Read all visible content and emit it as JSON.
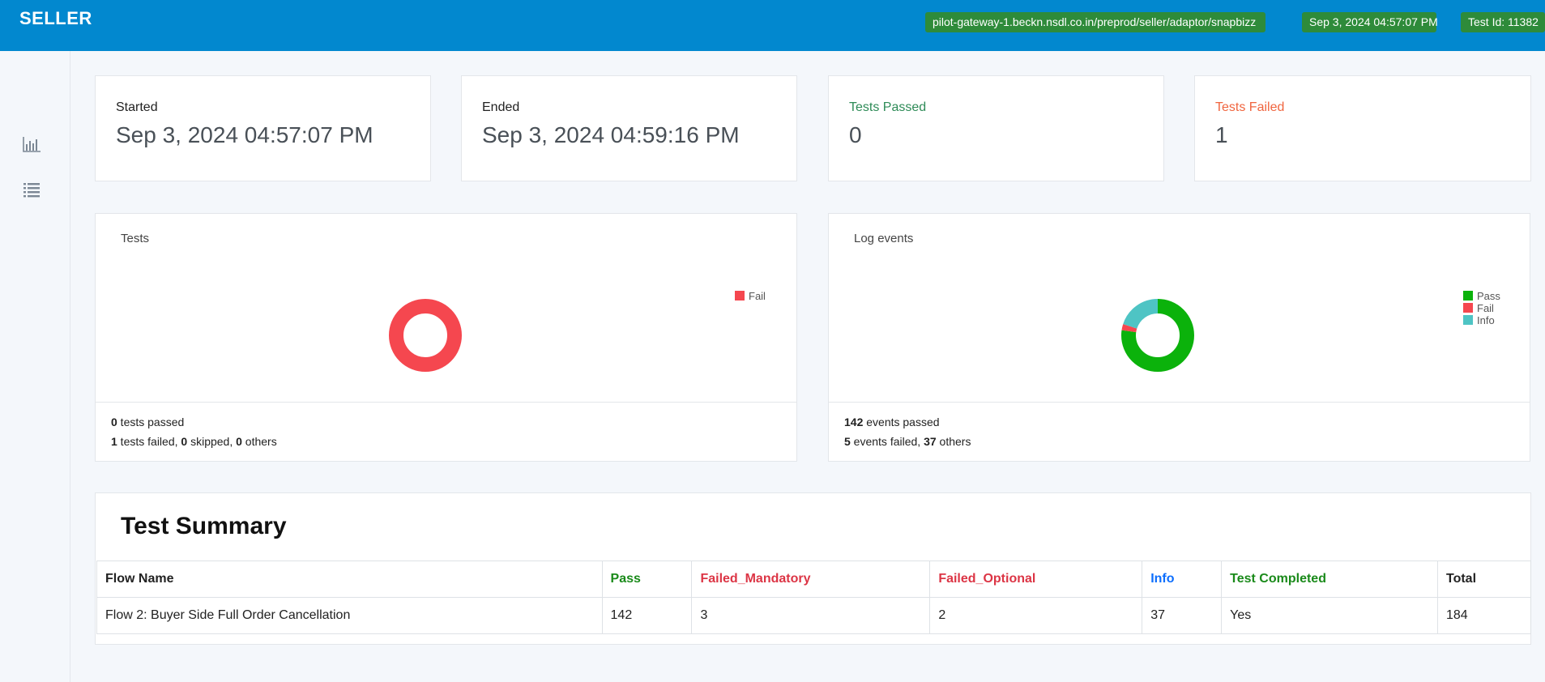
{
  "header": {
    "brand": "SELLER",
    "url_badge": "pilot-gateway-1.beckn.nsdl.co.in/preprod/seller/adaptor/snapbizz",
    "date_badge": "Sep 3, 2024 04:57:07 PM",
    "test_id_badge": "Test Id: 11382",
    "colors": {
      "bar": "#0288cf",
      "badge": "#2e8b3a"
    }
  },
  "sidebar": {
    "items": [
      {
        "icon": "bar-chart-icon"
      },
      {
        "icon": "list-icon"
      }
    ]
  },
  "stats": {
    "started": {
      "label": "Started",
      "value": "Sep 3, 2024 04:57:07 PM"
    },
    "ended": {
      "label": "Ended",
      "value": "Sep 3, 2024 04:59:16 PM"
    },
    "passed": {
      "label": "Tests Passed",
      "value": "0",
      "color": "#2e8b57"
    },
    "failed": {
      "label": "Tests Failed",
      "value": "1",
      "color": "#f0653f"
    }
  },
  "tests_panel": {
    "title": "Tests",
    "footer": {
      "passed_count": "0",
      "passed_text": " tests passed",
      "failed_count": "1",
      "failed_text": " tests failed, ",
      "skipped_count": "0",
      "skipped_text": " skipped, ",
      "others_count": "0",
      "others_text": " others"
    }
  },
  "log_panel": {
    "title": "Log events",
    "footer": {
      "passed_count": "142",
      "passed_text": " events passed",
      "failed_count": "5",
      "failed_text": " events failed, ",
      "others_count": "37",
      "others_text": " others"
    }
  },
  "chart_data": [
    {
      "type": "pie",
      "title": "Tests",
      "donut": true,
      "legend_position": "top-right",
      "series": [
        {
          "name": "Fail",
          "value": 1,
          "color": "#f5474f"
        }
      ]
    },
    {
      "type": "pie",
      "title": "Log events",
      "donut": true,
      "legend_position": "top-right",
      "series": [
        {
          "name": "Pass",
          "value": 142,
          "color": "#0bb20b"
        },
        {
          "name": "Fail",
          "value": 5,
          "color": "#f5474f"
        },
        {
          "name": "Info",
          "value": 37,
          "color": "#4ec4c4"
        }
      ]
    }
  ],
  "summary": {
    "title": "Test Summary",
    "columns": [
      "Flow Name",
      "Pass",
      "Failed_Mandatory",
      "Failed_Optional",
      "Info",
      "Test Completed",
      "Total"
    ],
    "rows": [
      [
        "Flow 2: Buyer Side Full Order Cancellation",
        "142",
        "3",
        "2",
        "37",
        "Yes",
        "184"
      ]
    ]
  }
}
